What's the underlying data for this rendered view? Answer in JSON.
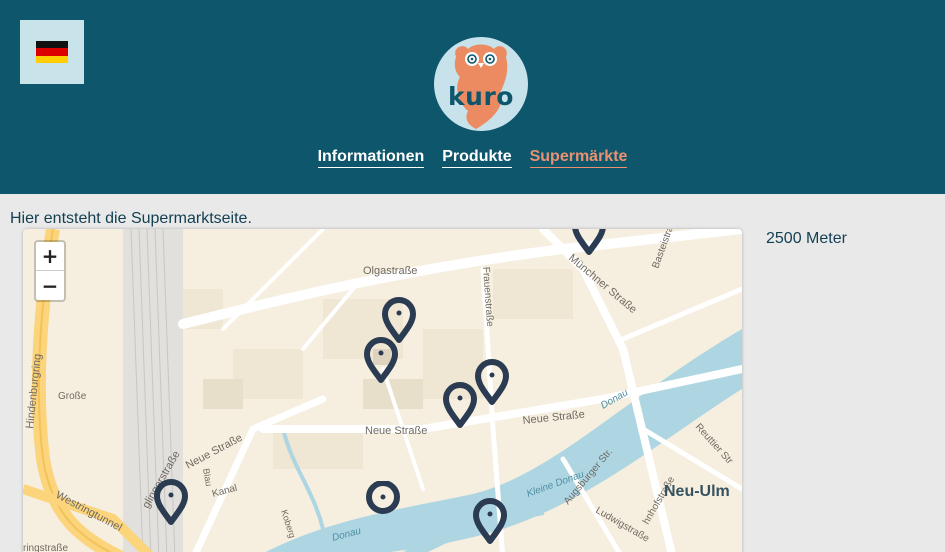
{
  "header": {
    "language": "Deutsch",
    "flag_colors": [
      "#111111",
      "#dd0000",
      "#ffce00"
    ],
    "logo_text": "kuro",
    "nav": [
      {
        "label": "Informationen",
        "active": false
      },
      {
        "label": "Produkte",
        "active": false
      },
      {
        "label": "Supermärkte",
        "active": true
      }
    ]
  },
  "main": {
    "intro": "Hier entsteht die Supermarktseite.",
    "distance": "2500 Meter"
  },
  "map": {
    "zoom_in": "+",
    "zoom_out": "−",
    "street_labels": {
      "olgastrasse": "Olgastraße",
      "neue_strasse_1": "Neue Straße",
      "neue_strasse_2": "Neue Straße",
      "neue_strasse_3": "Neue Straße",
      "muenchner_strasse": "Münchner Straße",
      "frauenstrasse": "Frauenstraße",
      "basteistrasse": "Basteistraße",
      "hindenburgring": "Hindenburgring",
      "westringtunnel": "Westringtunnel",
      "donau": "Donau",
      "kleine_donau": "Kleine Donau",
      "augsburger_str": "Augsburger Str.",
      "ludwigstrasse": "Ludwigstraße",
      "reuttier_str": "Reuttier Str",
      "neu_ulm": "Neu-Ulm",
      "grosse": "Große",
      "glinger": "glingerstraße",
      "bahnhofstrasse": "hnhofstraße",
      "kanal": "Kanal",
      "koberg": "Koberg",
      "blau": "Blau",
      "donau_small": "Donau",
      "westring_end": "ringstraße"
    },
    "marker_count": 9,
    "colors": {
      "marker": "#2a3b52",
      "water": "#aed6e2",
      "land": "#f6efe0",
      "road": "#ffffff",
      "highway": "#fbd47b"
    }
  }
}
